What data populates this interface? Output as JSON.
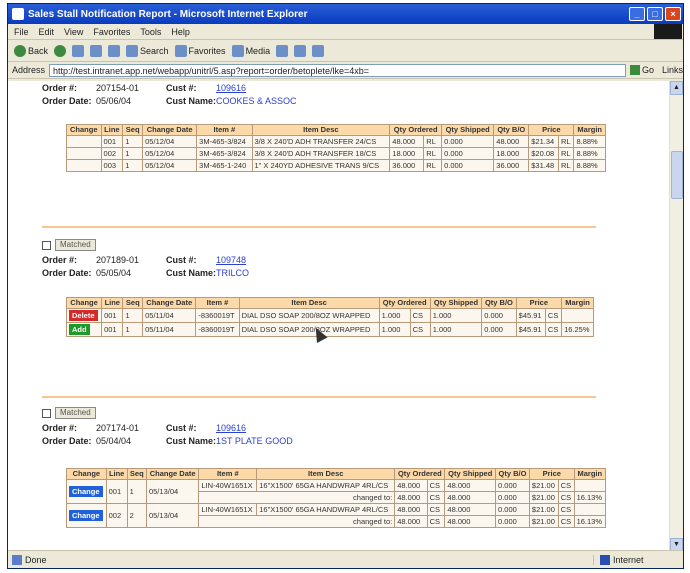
{
  "window": {
    "title": "Sales Stall Notification Report - Microsoft Internet Explorer",
    "min": "_",
    "max": "□",
    "close": "×"
  },
  "menu": [
    "File",
    "Edit",
    "View",
    "Favorites",
    "Tools",
    "Help"
  ],
  "toolbar": {
    "back": "Back",
    "search": "Search",
    "favorites": "Favorites",
    "media": "Media"
  },
  "address": {
    "label": "Address",
    "url": "http://test.intranet.app.net/webapp/unitrl/5.asp?report=order/betoplete/lke=4xb=",
    "go": "Go",
    "links": "Links"
  },
  "status": {
    "text": "Done",
    "zone": "Internet"
  },
  "order1": {
    "order_label": "Order #:",
    "order_no": "207154-01",
    "cust_label": "Cust #:",
    "cust_no": "109616",
    "date_label": "Order Date:",
    "date": "05/06/04",
    "name_label": "Cust Name:",
    "name": "COOKES & ASSOC"
  },
  "order2": {
    "order_label": "Order #:",
    "order_no": "207189-01",
    "cust_label": "Cust #:",
    "cust_no": "109748",
    "date_label": "Order Date:",
    "date": "05/05/04",
    "name_label": "Cust Name:",
    "name": "TRILCO"
  },
  "order3": {
    "order_label": "Order #:",
    "order_no": "207174-01",
    "cust_label": "Cust #:",
    "cust_no": "109616",
    "date_label": "Order Date:",
    "date": "05/04/04",
    "name_label": "Cust Name:",
    "name": "1ST PLATE GOOD"
  },
  "matched_label": "Matched",
  "headers": {
    "change": "Change",
    "line": "Line",
    "seq": "Seq",
    "change_date": "Change Date",
    "item": "Item #",
    "item_desc": "Item Desc",
    "qty_ordered": "Qty Ordered",
    "qty_shipped": "Qty Shipped",
    "qty_bo": "Qty B/O",
    "price": "Price",
    "margin": "Margin"
  },
  "table1": [
    {
      "change": "",
      "line": "001",
      "seq": "1",
      "date": "05/12/04",
      "item": "3M-465-3/824",
      "desc": "3/8 X 240'D ADH TRANSFER 24/CS",
      "qty_o": "48.000",
      "u1": "RL",
      "qty_s": "0.000",
      "qty_b": "48.000",
      "price": "$21.34",
      "u2": "RL",
      "margin": "8.88%"
    },
    {
      "change": "",
      "line": "002",
      "seq": "1",
      "date": "05/12/04",
      "item": "3M-465-3/824",
      "desc": "3/8 X 240'D ADH TRANSFER 18/CS",
      "qty_o": "18.000",
      "u1": "RL",
      "qty_s": "0.000",
      "qty_b": "18.000",
      "price": "$20.08",
      "u2": "RL",
      "margin": "8.88%"
    },
    {
      "change": "",
      "line": "003",
      "seq": "1",
      "date": "05/12/04",
      "item": "3M-465-1-240",
      "desc": "1\" X 240YD ADHESIVE TRANS 9/CS",
      "qty_o": "36.000",
      "u1": "RL",
      "qty_s": "0.000",
      "qty_b": "36.000",
      "price": "$31.48",
      "u2": "RL",
      "margin": "8.88%"
    }
  ],
  "table2": [
    {
      "change": "Delete",
      "badge": "del",
      "line": "001",
      "seq": "1",
      "date": "05/11/04",
      "item": "-8360019T",
      "desc": "DIAL DSO SOAP 200/8OZ WRAPPED",
      "qty_o": "1.000",
      "u1": "CS",
      "qty_s": "1.000",
      "qty_b": "0.000",
      "price": "$45.91",
      "u2": "CS",
      "margin": ""
    },
    {
      "change": "Add",
      "badge": "add",
      "line": "001",
      "seq": "1",
      "date": "05/11/04",
      "item": "-8360019T",
      "desc": "DIAL DSO SOAP 200/8OZ WRAPPED",
      "qty_o": "1.000",
      "u1": "CS",
      "qty_s": "1.000",
      "qty_b": "0.000",
      "price": "$45.91",
      "u2": "CS",
      "margin": "16.25%"
    }
  ],
  "table3": [
    {
      "change": "Change",
      "badge": "chg",
      "line": "001",
      "seq": "1",
      "date": "05/13/04",
      "item": "LIN-40W1651X",
      "desc": "16\"X1500' 65GA HANDWRAP 4RL/CS",
      "qty_o": "48.000",
      "u1": "CS",
      "qty_s": "48.000",
      "qty_b": "0.000",
      "price": "$21.00",
      "u2": "CS",
      "margin": "",
      "changed_label": "changed to:",
      "c_qty_o": "48.000",
      "c_u1": "CS",
      "c_qty_s": "48.000",
      "c_qty_b": "0.000",
      "c_price": "$21.00",
      "c_u2": "CS",
      "c_margin": "16.13%"
    },
    {
      "change": "Change",
      "badge": "chg",
      "line": "002",
      "seq": "2",
      "date": "05/13/04",
      "item": "LIN-40W1651X",
      "desc": "16\"X1500' 65GA HANDWRAP 4RL/CS",
      "qty_o": "48.000",
      "u1": "CS",
      "qty_s": "48.000",
      "qty_b": "0.000",
      "price": "$21.00",
      "u2": "CS",
      "margin": "",
      "changed_label": "changed to:",
      "c_qty_o": "48.000",
      "c_u1": "CS",
      "c_qty_s": "48.000",
      "c_qty_b": "0.000",
      "c_price": "$21.00",
      "c_u2": "CS",
      "c_margin": "16.13%"
    }
  ]
}
